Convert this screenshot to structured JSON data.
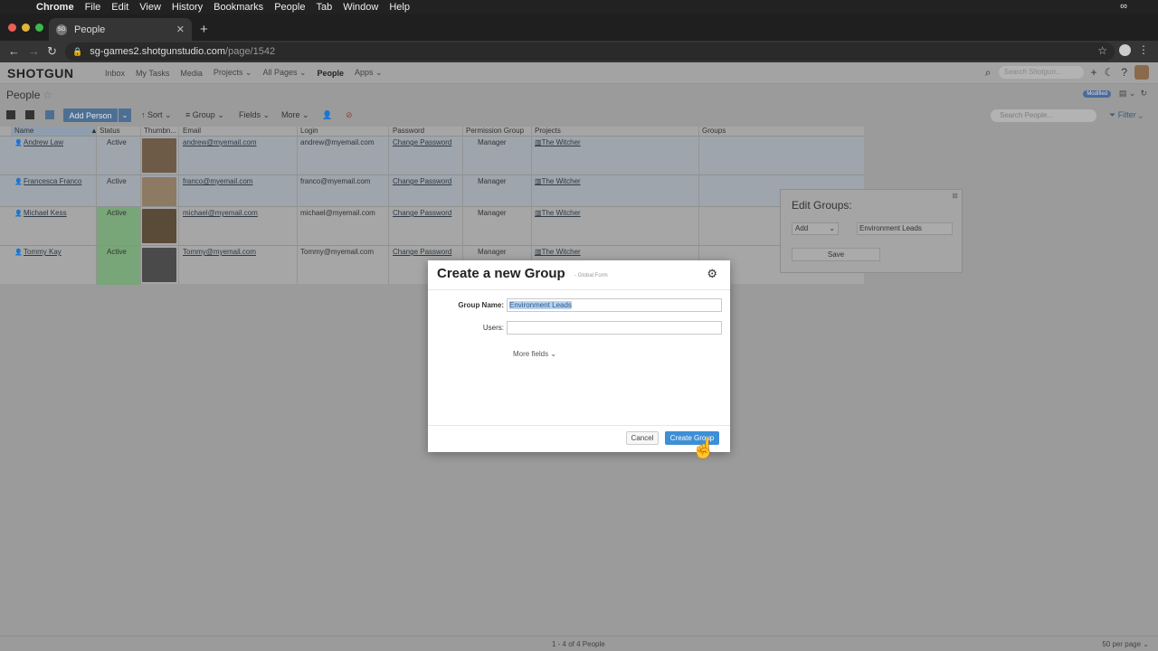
{
  "menubar": {
    "app": "Chrome",
    "items": [
      "File",
      "Edit",
      "View",
      "History",
      "Bookmarks",
      "People",
      "Tab",
      "Window",
      "Help"
    ]
  },
  "browser": {
    "tab_title": "People",
    "favicon_text": "SG",
    "url_host": "sg-games2.shotgunstudio.com",
    "url_path": "/page/1542"
  },
  "topnav": {
    "logo": "SHOTGUN",
    "items": [
      "Inbox",
      "My Tasks",
      "Media",
      "Projects ⌄",
      "All Pages ⌄",
      "People",
      "Apps ⌄"
    ],
    "search_placeholder": "Search Shotgun..."
  },
  "page": {
    "title": "People",
    "modified_badge": "Modified"
  },
  "toolbar": {
    "add_person": "Add Person",
    "sort": "Sort",
    "group": "Group",
    "fields": "Fields",
    "more": "More",
    "search_placeholder": "Search People...",
    "filter": "Filter"
  },
  "table": {
    "columns": [
      "Name",
      "Status",
      "Thumbn...",
      "Email",
      "Login",
      "Password",
      "Permission Group",
      "Projects",
      "Groups"
    ],
    "rows": [
      {
        "name": "Andrew Law",
        "status": "Active",
        "email": "andrew@myemail.com",
        "login": "andrew@myemail.com",
        "password": "Change Password",
        "permission": "Manager",
        "project": "The Witcher",
        "groups": ""
      },
      {
        "name": "Francesca Franco",
        "status": "Active",
        "email": "franco@myemail.com",
        "login": "franco@myemail.com",
        "password": "Change Password",
        "permission": "Manager",
        "project": "The Witcher",
        "groups": ""
      },
      {
        "name": "Michael Kess",
        "status": "Active",
        "email": "michael@myemail.com",
        "login": "michael@myemail.com",
        "password": "Change Password",
        "permission": "Manager",
        "project": "The Witcher",
        "groups": ""
      },
      {
        "name": "Tommy Kay",
        "status": "Active",
        "email": "Tommy@myemail.com",
        "login": "Tommy@myemail.com",
        "password": "Change Password",
        "permission": "Manager",
        "project": "The Witcher",
        "groups": ""
      }
    ]
  },
  "edit_groups": {
    "title": "Edit Groups:",
    "action": "Add",
    "value": "Environment Leads",
    "save": "Save"
  },
  "footer": {
    "count": "1 - 4 of 4 People",
    "per_page": "50 per page"
  },
  "modal": {
    "title": "Create a new Group",
    "subtitle": "Global Form",
    "group_name_label": "Group Name:",
    "group_name_value": "Environment Leads",
    "users_label": "Users:",
    "users_value": "",
    "more_fields": "More fields",
    "cancel": "Cancel",
    "create": "Create Group"
  },
  "colors": {
    "accent": "#3d8fd6",
    "status_active": "#78a678"
  }
}
